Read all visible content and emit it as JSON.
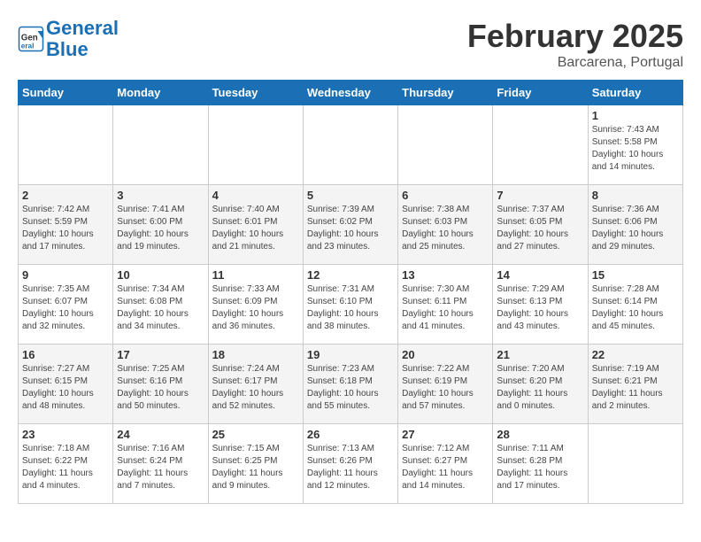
{
  "header": {
    "logo_line1": "General",
    "logo_line2": "Blue",
    "month_title": "February 2025",
    "location": "Barcarena, Portugal"
  },
  "days_of_week": [
    "Sunday",
    "Monday",
    "Tuesday",
    "Wednesday",
    "Thursday",
    "Friday",
    "Saturday"
  ],
  "weeks": [
    [
      {
        "day": "",
        "info": ""
      },
      {
        "day": "",
        "info": ""
      },
      {
        "day": "",
        "info": ""
      },
      {
        "day": "",
        "info": ""
      },
      {
        "day": "",
        "info": ""
      },
      {
        "day": "",
        "info": ""
      },
      {
        "day": "1",
        "info": "Sunrise: 7:43 AM\nSunset: 5:58 PM\nDaylight: 10 hours and 14 minutes."
      }
    ],
    [
      {
        "day": "2",
        "info": "Sunrise: 7:42 AM\nSunset: 5:59 PM\nDaylight: 10 hours and 17 minutes."
      },
      {
        "day": "3",
        "info": "Sunrise: 7:41 AM\nSunset: 6:00 PM\nDaylight: 10 hours and 19 minutes."
      },
      {
        "day": "4",
        "info": "Sunrise: 7:40 AM\nSunset: 6:01 PM\nDaylight: 10 hours and 21 minutes."
      },
      {
        "day": "5",
        "info": "Sunrise: 7:39 AM\nSunset: 6:02 PM\nDaylight: 10 hours and 23 minutes."
      },
      {
        "day": "6",
        "info": "Sunrise: 7:38 AM\nSunset: 6:03 PM\nDaylight: 10 hours and 25 minutes."
      },
      {
        "day": "7",
        "info": "Sunrise: 7:37 AM\nSunset: 6:05 PM\nDaylight: 10 hours and 27 minutes."
      },
      {
        "day": "8",
        "info": "Sunrise: 7:36 AM\nSunset: 6:06 PM\nDaylight: 10 hours and 29 minutes."
      }
    ],
    [
      {
        "day": "9",
        "info": "Sunrise: 7:35 AM\nSunset: 6:07 PM\nDaylight: 10 hours and 32 minutes."
      },
      {
        "day": "10",
        "info": "Sunrise: 7:34 AM\nSunset: 6:08 PM\nDaylight: 10 hours and 34 minutes."
      },
      {
        "day": "11",
        "info": "Sunrise: 7:33 AM\nSunset: 6:09 PM\nDaylight: 10 hours and 36 minutes."
      },
      {
        "day": "12",
        "info": "Sunrise: 7:31 AM\nSunset: 6:10 PM\nDaylight: 10 hours and 38 minutes."
      },
      {
        "day": "13",
        "info": "Sunrise: 7:30 AM\nSunset: 6:11 PM\nDaylight: 10 hours and 41 minutes."
      },
      {
        "day": "14",
        "info": "Sunrise: 7:29 AM\nSunset: 6:13 PM\nDaylight: 10 hours and 43 minutes."
      },
      {
        "day": "15",
        "info": "Sunrise: 7:28 AM\nSunset: 6:14 PM\nDaylight: 10 hours and 45 minutes."
      }
    ],
    [
      {
        "day": "16",
        "info": "Sunrise: 7:27 AM\nSunset: 6:15 PM\nDaylight: 10 hours and 48 minutes."
      },
      {
        "day": "17",
        "info": "Sunrise: 7:25 AM\nSunset: 6:16 PM\nDaylight: 10 hours and 50 minutes."
      },
      {
        "day": "18",
        "info": "Sunrise: 7:24 AM\nSunset: 6:17 PM\nDaylight: 10 hours and 52 minutes."
      },
      {
        "day": "19",
        "info": "Sunrise: 7:23 AM\nSunset: 6:18 PM\nDaylight: 10 hours and 55 minutes."
      },
      {
        "day": "20",
        "info": "Sunrise: 7:22 AM\nSunset: 6:19 PM\nDaylight: 10 hours and 57 minutes."
      },
      {
        "day": "21",
        "info": "Sunrise: 7:20 AM\nSunset: 6:20 PM\nDaylight: 11 hours and 0 minutes."
      },
      {
        "day": "22",
        "info": "Sunrise: 7:19 AM\nSunset: 6:21 PM\nDaylight: 11 hours and 2 minutes."
      }
    ],
    [
      {
        "day": "23",
        "info": "Sunrise: 7:18 AM\nSunset: 6:22 PM\nDaylight: 11 hours and 4 minutes."
      },
      {
        "day": "24",
        "info": "Sunrise: 7:16 AM\nSunset: 6:24 PM\nDaylight: 11 hours and 7 minutes."
      },
      {
        "day": "25",
        "info": "Sunrise: 7:15 AM\nSunset: 6:25 PM\nDaylight: 11 hours and 9 minutes."
      },
      {
        "day": "26",
        "info": "Sunrise: 7:13 AM\nSunset: 6:26 PM\nDaylight: 11 hours and 12 minutes."
      },
      {
        "day": "27",
        "info": "Sunrise: 7:12 AM\nSunset: 6:27 PM\nDaylight: 11 hours and 14 minutes."
      },
      {
        "day": "28",
        "info": "Sunrise: 7:11 AM\nSunset: 6:28 PM\nDaylight: 11 hours and 17 minutes."
      },
      {
        "day": "",
        "info": ""
      }
    ]
  ]
}
